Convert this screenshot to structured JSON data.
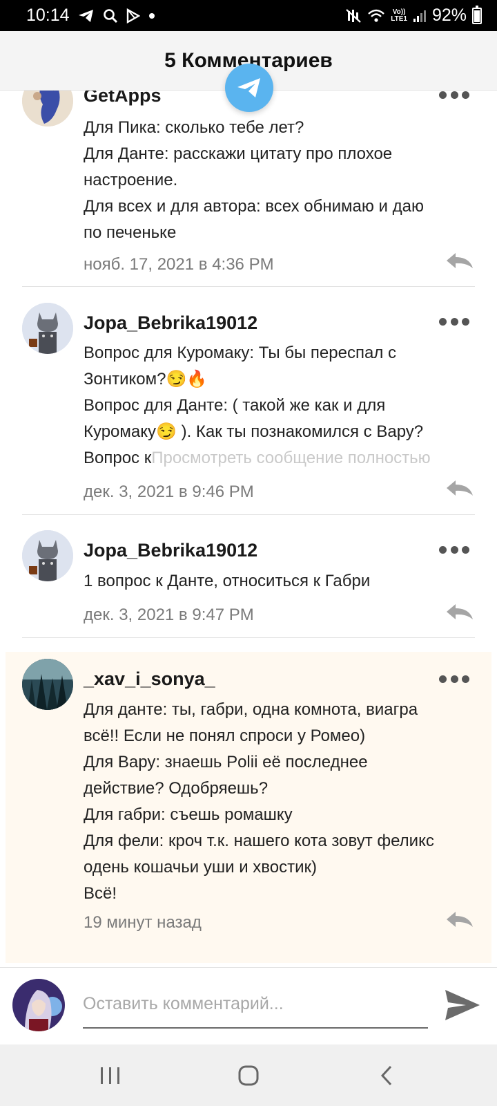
{
  "status_bar": {
    "time": "10:14",
    "lte_top": "Vo))",
    "lte_bottom": "LTE1",
    "battery": "92%",
    "battery_level": 0.92,
    "icons": [
      "telegram-icon",
      "search-icon",
      "play-store-icon",
      "dot-icon",
      "mute-icon",
      "wifi-icon",
      "signal-icon",
      "battery-icon"
    ]
  },
  "header": {
    "title": "5 Комментариев"
  },
  "colors": {
    "telegram_blue": "#5ab4ef",
    "highlight_bg": "#fff9f0",
    "timestamp_gray": "#7a7a7a"
  },
  "comments": [
    {
      "username": "GetApps",
      "lines": [
        "Для Пика: сколько тебе лет?",
        "Для Данте: расскажи цитату про плохое",
        "настроение.",
        "Для всех и для автора: всех обнимаю и даю",
        "по печеньке"
      ],
      "timestamp": "нояб. 17, 2021 в 4:36 PM"
    },
    {
      "username": "Jopa_Bebrika19012",
      "lines": [
        "Вопрос для Куромаку: Ты бы переспал с",
        "Зонтиком?😏🔥",
        "Вопрос для Данте: ( такой же как и для",
        "Куромаку😏 ). Как ты познакомился с Вару?",
        "Вопрос к"
      ],
      "view_full": "Просмотреть сообщение полностью",
      "timestamp": "дек. 3, 2021 в 9:46 PM"
    },
    {
      "username": "Jopa_Bebrika19012",
      "lines": [
        "1 вопрос к Данте, относиться к Габри"
      ],
      "timestamp": "дек. 3, 2021 в 9:47 PM"
    },
    {
      "username": "_xav_i_sonya_",
      "lines": [
        "Для данте: ты, габри, одна комнота, виагра",
        "всё!! Если не понял спроси у Ромео)",
        "Для Вару: знаешь Polii её последнее",
        "действие? Одобряешь?",
        "Для габри: съешь ромашку",
        "Для фели: кроч т.к. нашего кота зовут феликс",
        "одень кошачьи уши и хвостик)",
        "Всё!"
      ],
      "timestamp": "19 минут назад"
    }
  ],
  "input": {
    "placeholder": "Оставить комментарий..."
  }
}
